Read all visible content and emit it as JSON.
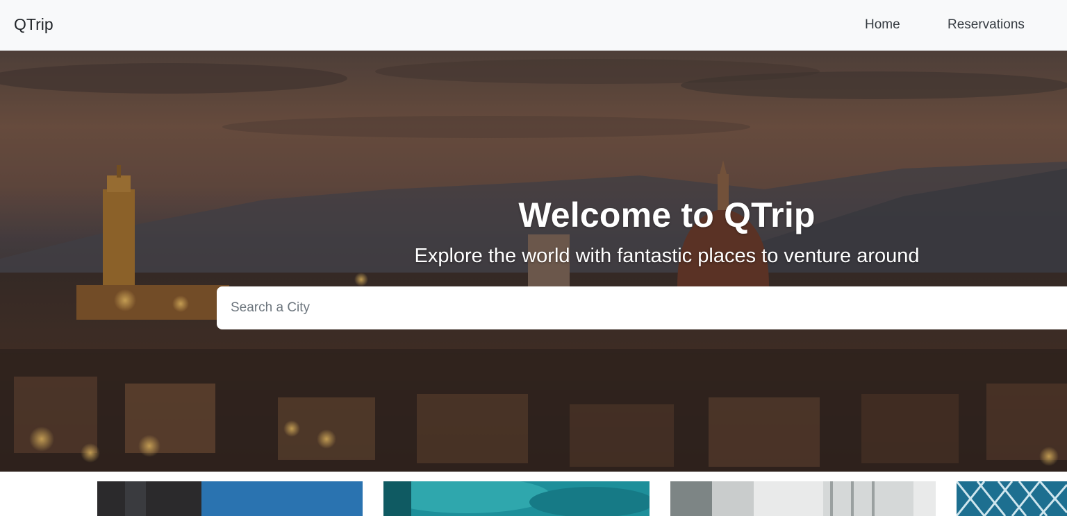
{
  "navbar": {
    "brand": "QTrip",
    "links": [
      {
        "label": "Home"
      },
      {
        "label": "Reservations"
      }
    ]
  },
  "hero": {
    "title": "Welcome to QTrip",
    "subtitle": "Explore the world with fantastic places to venture around",
    "search": {
      "placeholder": "Search a City",
      "value": ""
    }
  },
  "colors": {
    "navbar_bg": "#f8f9fa",
    "hero_overlay": "#2b2522",
    "text_light": "#ffffff"
  }
}
